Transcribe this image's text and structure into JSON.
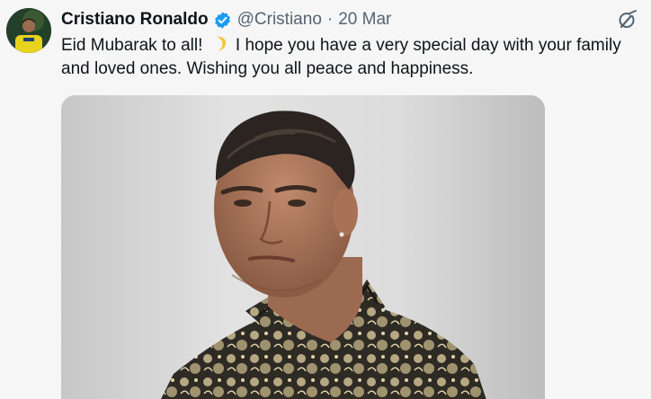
{
  "tweet": {
    "author_name": "Cristiano Ronaldo",
    "handle": "@Cristiano",
    "separator": "·",
    "date": "20 Mar",
    "text_part1": "Eid Mubarak to all! ",
    "text_part2": " I hope you have a very special day with your family and loved ones. Wishing you all peace and happiness."
  },
  "icons": {
    "verified": "verified-badge-icon",
    "grok": "grok-icon",
    "emoji": "crescent-moon-emoji"
  },
  "colors": {
    "verified_blue": "#1d9bf0",
    "secondary_text": "#536471",
    "primary_text": "#0f1419"
  }
}
